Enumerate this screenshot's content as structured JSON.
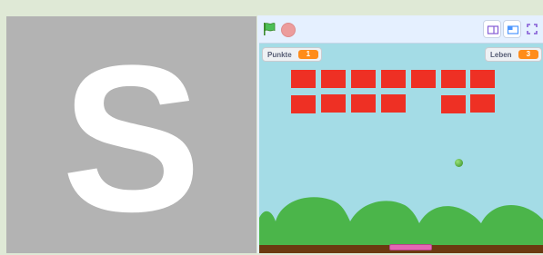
{
  "thumbnail": {
    "letter": "S",
    "background_color": "#b3b3b3",
    "letter_color": "#ffffff"
  },
  "toolbar": {
    "green_flag_icon": "green-flag-icon",
    "stop_icon": "stop-sign-icon",
    "small_stage_icon": "small-stage-icon",
    "normal_stage_icon": "normal-stage-icon",
    "fullscreen_icon": "fullscreen-icon"
  },
  "game": {
    "score_label": "Punkte",
    "score_value": "1",
    "lives_label": "Leben",
    "lives_value": "3",
    "colors": {
      "sky": "#a4dce6",
      "brick": "#ee3024",
      "hills": "#4bb54a",
      "ground": "#6b3a10",
      "paddle": "#e566b3",
      "monitor_value": "#ff8c1a"
    }
  }
}
